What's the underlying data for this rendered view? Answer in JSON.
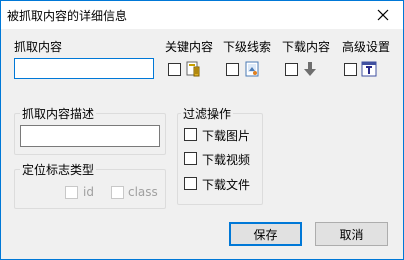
{
  "window": {
    "title": "被抓取内容的详细信息"
  },
  "fields": {
    "capture_content_label": "抓取内容",
    "capture_content_value": "",
    "capture_desc_label": "抓取内容描述",
    "capture_desc_value": ""
  },
  "options": {
    "keyword_label": "关键内容",
    "sub_clue_label": "下级线索",
    "download_label": "下载内容",
    "advanced_label": "高级设置"
  },
  "locator_group": {
    "title": "定位标志类型",
    "id_label": "id",
    "class_label": "class"
  },
  "filter_group": {
    "title": "过滤操作",
    "items": [
      {
        "label": "下载图片"
      },
      {
        "label": "下载视频"
      },
      {
        "label": "下载文件"
      }
    ]
  },
  "buttons": {
    "save": "保存",
    "cancel": "取消"
  },
  "colors": {
    "accent": "#0078d7",
    "window_bg": "#f0f0f0",
    "button_bg": "#e1e1e1"
  },
  "icons": [
    "close-icon",
    "keyword-icon",
    "sub-clue-icon",
    "download-arrow-icon",
    "advanced-settings-icon"
  ]
}
